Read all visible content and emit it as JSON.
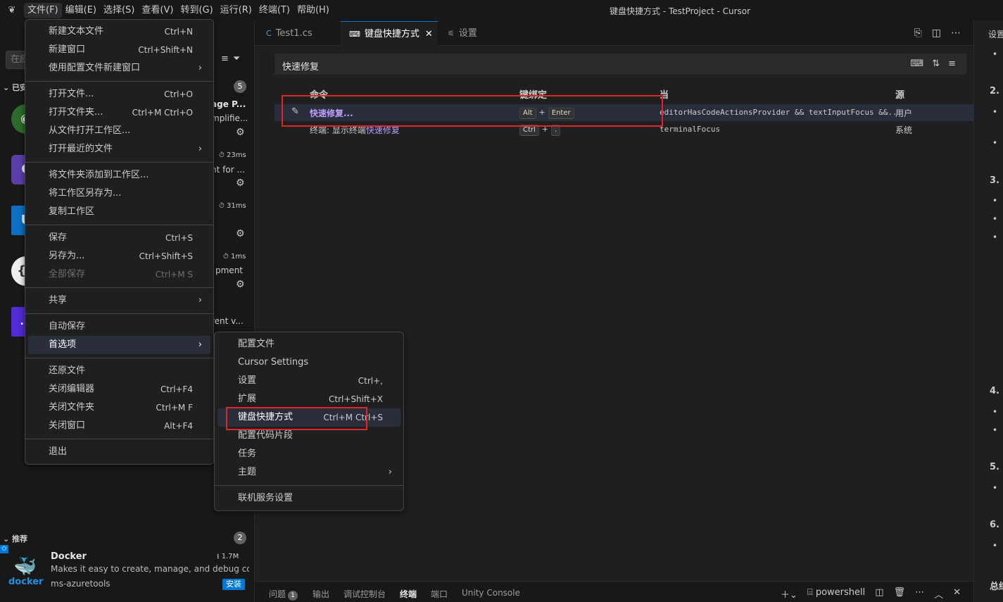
{
  "window_title": "键盘快捷方式 - TestProject - Cursor",
  "menubar": [
    "文件(F)",
    "编辑(E)",
    "选择(S)",
    "查看(V)",
    "转到(G)",
    "运行(R)",
    "终端(T)",
    "帮助(H)"
  ],
  "file_menu": {
    "groups": [
      [
        {
          "label": "新建文本文件",
          "shortcut": "Ctrl+N"
        },
        {
          "label": "新建窗口",
          "shortcut": "Ctrl+Shift+N"
        },
        {
          "label": "使用配置文件新建窗口",
          "submenu": true
        }
      ],
      [
        {
          "label": "打开文件...",
          "shortcut": "Ctrl+O"
        },
        {
          "label": "打开文件夹...",
          "shortcut": "Ctrl+M Ctrl+O"
        },
        {
          "label": "从文件打开工作区..."
        },
        {
          "label": "打开最近的文件",
          "submenu": true
        }
      ],
      [
        {
          "label": "将文件夹添加到工作区..."
        },
        {
          "label": "将工作区另存为..."
        },
        {
          "label": "复制工作区"
        }
      ],
      [
        {
          "label": "保存",
          "shortcut": "Ctrl+S"
        },
        {
          "label": "另存为...",
          "shortcut": "Ctrl+Shift+S"
        },
        {
          "label": "全部保存",
          "shortcut": "Ctrl+M S",
          "disabled": true
        }
      ],
      [
        {
          "label": "共享",
          "submenu": true
        }
      ],
      [
        {
          "label": "自动保存"
        },
        {
          "label": "首选项",
          "submenu": true,
          "highlighted": true
        }
      ],
      [
        {
          "label": "还原文件"
        },
        {
          "label": "关闭编辑器",
          "shortcut": "Ctrl+F4"
        },
        {
          "label": "关闭文件夹",
          "shortcut": "Ctrl+M F"
        },
        {
          "label": "关闭窗口",
          "shortcut": "Alt+F4"
        }
      ],
      [
        {
          "label": "退出"
        }
      ]
    ]
  },
  "prefs_menu": {
    "groups": [
      [
        {
          "label": "配置文件"
        },
        {
          "label": "Cursor Settings"
        },
        {
          "label": "设置",
          "shortcut": "Ctrl+,"
        },
        {
          "label": "扩展",
          "shortcut": "Ctrl+Shift+X"
        },
        {
          "label": "键盘快捷方式",
          "shortcut": "Ctrl+M Ctrl+S",
          "highlighted": true
        },
        {
          "label": "配置代码片段"
        },
        {
          "label": "任务"
        },
        {
          "label": "主题",
          "submenu": true
        }
      ],
      [
        {
          "label": "联机服务设置"
        }
      ]
    ]
  },
  "sidebar": {
    "search_placeholder": "在应",
    "installed_label": "已安",
    "installed_count": "5",
    "frag_1a": "age P...",
    "frag_1b": "mplifie...",
    "timing_1": "23ms",
    "frag_2a": "nt for ...",
    "timing_2": "31ms",
    "timing_3": "1ms",
    "frag_3": "pment",
    "frag_4": "rent v...",
    "icon_u": "U",
    "icon_n": ".N",
    "recommended_label": "推荐",
    "recommended_count": "2",
    "rec": {
      "name": "Docker",
      "downloads": "1.7M",
      "description": "Makes it easy to create, manage, and debug co...",
      "publisher": "ms-azuretools",
      "install": "安装",
      "logo_text": "docker"
    }
  },
  "tabs": [
    {
      "label": "Test1.cs",
      "icon": "csharp-icon"
    },
    {
      "label": "键盘快捷方式",
      "icon": "keyboard-icon",
      "active": true
    },
    {
      "label": "设置",
      "icon": "settings-icon"
    }
  ],
  "keybindings": {
    "search_value": "快速修复",
    "headers": {
      "command": "命令",
      "keybinding": "键绑定",
      "when": "当",
      "source": "源"
    },
    "rows": [
      {
        "command": "快速修复...",
        "keys": [
          "Alt",
          "Enter"
        ],
        "when": "editorHasCodeActionsProvider && textInputFocus &&...",
        "source": "用户"
      },
      {
        "command_prefix": "终端: 显示终端",
        "command_match": "快速修复",
        "keys": [
          "Ctrl",
          "."
        ],
        "when": "terminalFocus",
        "source": "系统"
      }
    ]
  },
  "panel": {
    "tabs": [
      "问题",
      "输出",
      "调试控制台",
      "终端",
      "端口",
      "Unity Console"
    ],
    "problems_count": "1",
    "active_tab": "终端",
    "shell": "powershell"
  },
  "right_strip": {
    "title": "设置",
    "nums": [
      "2.",
      "3.",
      "4.",
      "5.",
      "6.",
      "总结"
    ]
  },
  "colors": {
    "accent": "#0078d4",
    "highlight": "#e0242b",
    "match": "#b69cff"
  }
}
